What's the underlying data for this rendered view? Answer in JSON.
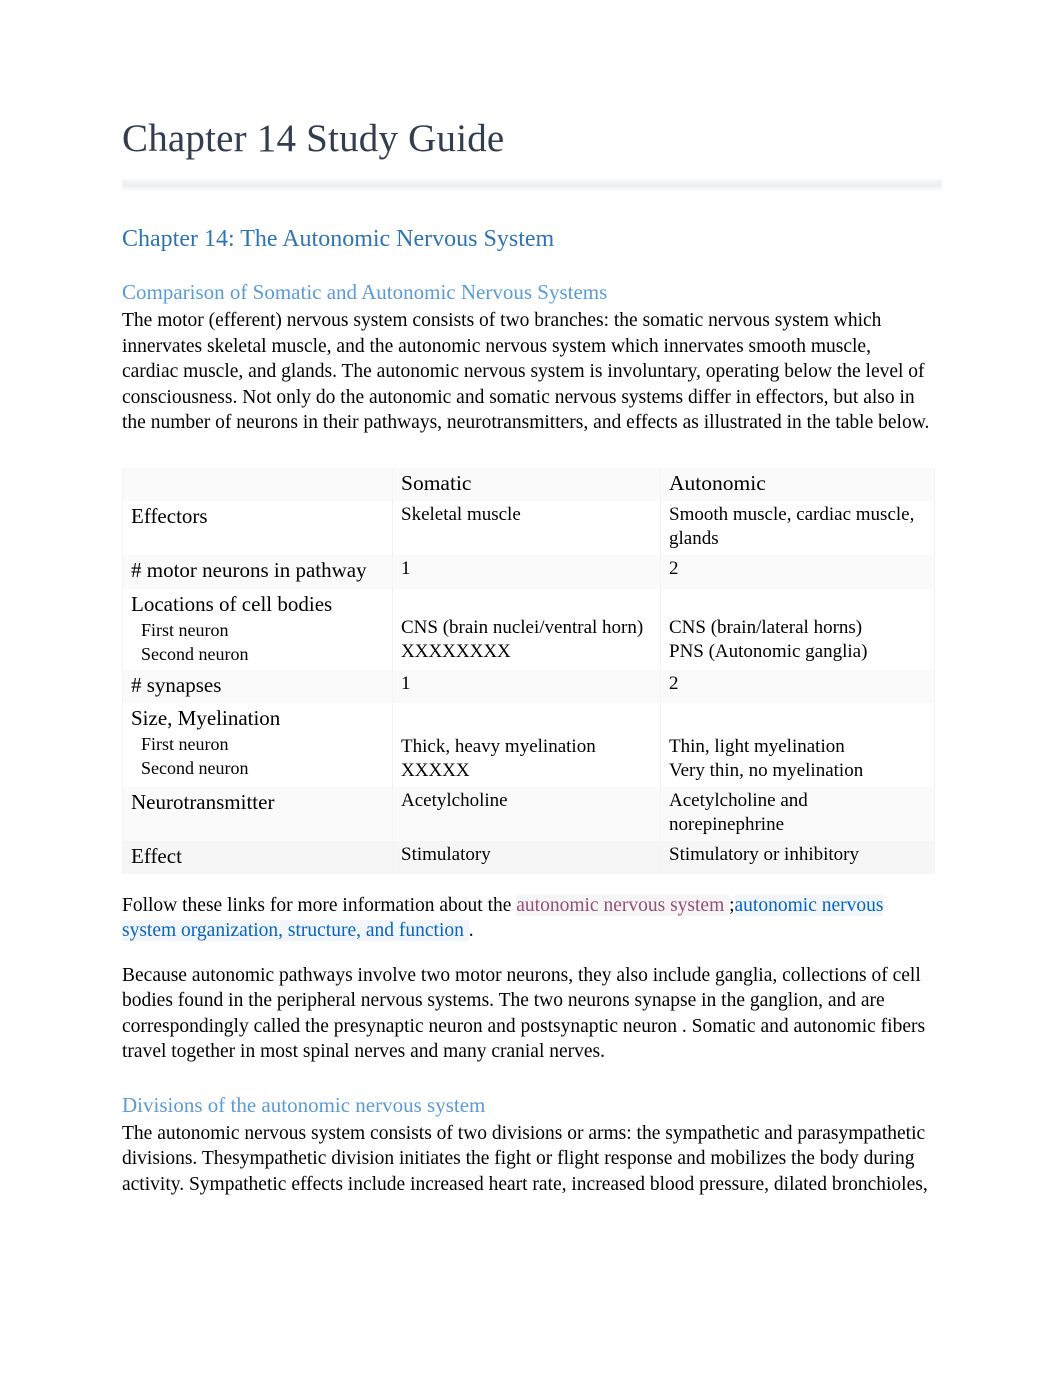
{
  "document": {
    "title": "Chapter 14 Study Guide",
    "heading1": "Chapter 14: The Autonomic Nervous System",
    "section1": {
      "heading": "Comparison of Somatic and Autonomic Nervous Systems",
      "paragraph": "The motor (efferent) nervous system consists of two branches: the somatic nervous system which innervates skeletal muscle, and the autonomic nervous system which innervates smooth muscle, cardiac muscle, and glands. The autonomic nervous system is involuntary, operating below the level of consciousness.  Not only do the autonomic and somatic nervous systems differ in effectors, but also in the number of neurons in their pathways, neurotransmitters, and effects as illustrated in the table below."
    },
    "links_paragraph": {
      "lead": "Follow these links for more information about the ",
      "link1": "autonomic nervous system ",
      "separator": ";",
      "link2": "autonomic nervous system organization, structure, and function ",
      "trailing": "."
    },
    "ganglia_paragraph": "Because autonomic pathways involve two motor neurons, they also include   ganglia, collections of cell bodies found in the peripheral nervous systems.    The two neurons synapse in the ganglion, and are correspondingly called the  presynaptic neuron   and postsynaptic neuron  . Somatic and autonomic fibers travel together in most spinal nerves and many cranial nerves.",
    "section2": {
      "heading": "Divisions of the autonomic nervous system",
      "paragraph": "The autonomic nervous system consists of two divisions or arms: the sympathetic and parasympathetic divisions. Thesympathetic division  initiates the fight or flight response  and mobilizes the body during activity. Sympathetic effects include increased heart rate, increased blood pressure, dilated bronchioles,"
    }
  },
  "table": {
    "headers": {
      "col1": "",
      "col2": "Somatic",
      "col3": "Autonomic"
    },
    "rows": [
      {
        "label": "Effectors",
        "sublabels": [],
        "somatic": [
          "Skeletal muscle"
        ],
        "autonomic": [
          "Smooth  muscle, cardiac muscle, glands"
        ]
      },
      {
        "label": "# motor neurons in pathway",
        "sublabels": [],
        "somatic": [
          "1"
        ],
        "autonomic": [
          "2"
        ]
      },
      {
        "label": "Locations of cell bodies",
        "sublabels": [
          "First neuron",
          "Second neuron"
        ],
        "somatic": [
          "CNS (brain nuclei/ventral horn)",
          "XXXXXXXX"
        ],
        "autonomic": [
          "CNS (brain/lateral horns)",
          "PNS (Autonomic ganglia)"
        ]
      },
      {
        "label": "# synapses",
        "sublabels": [],
        "somatic": [
          "1"
        ],
        "autonomic": [
          "2"
        ]
      },
      {
        "label": "Size, Myelination",
        "sublabels": [
          "First neuron",
          "Second neuron"
        ],
        "somatic": [
          "Thick, heavy myelination",
          "XXXXX"
        ],
        "autonomic": [
          "Thin, light myelination",
          "Very thin, no myelination"
        ]
      },
      {
        "label": "Neurotransmitter",
        "sublabels": [],
        "somatic": [
          "Acetylcholine"
        ],
        "autonomic": [
          "Acetylcholine and norepinephrine"
        ]
      },
      {
        "label": "Effect",
        "sublabels": [],
        "somatic": [
          "Stimulatory"
        ],
        "autonomic": [
          "Stimulatory or inhibitory"
        ]
      }
    ]
  },
  "colors": {
    "title": "#323E4F",
    "heading1": "#2E74B5",
    "heading2": "#5B9BD5",
    "link_visited": "#954F72",
    "link_blue": "#0563C1"
  }
}
